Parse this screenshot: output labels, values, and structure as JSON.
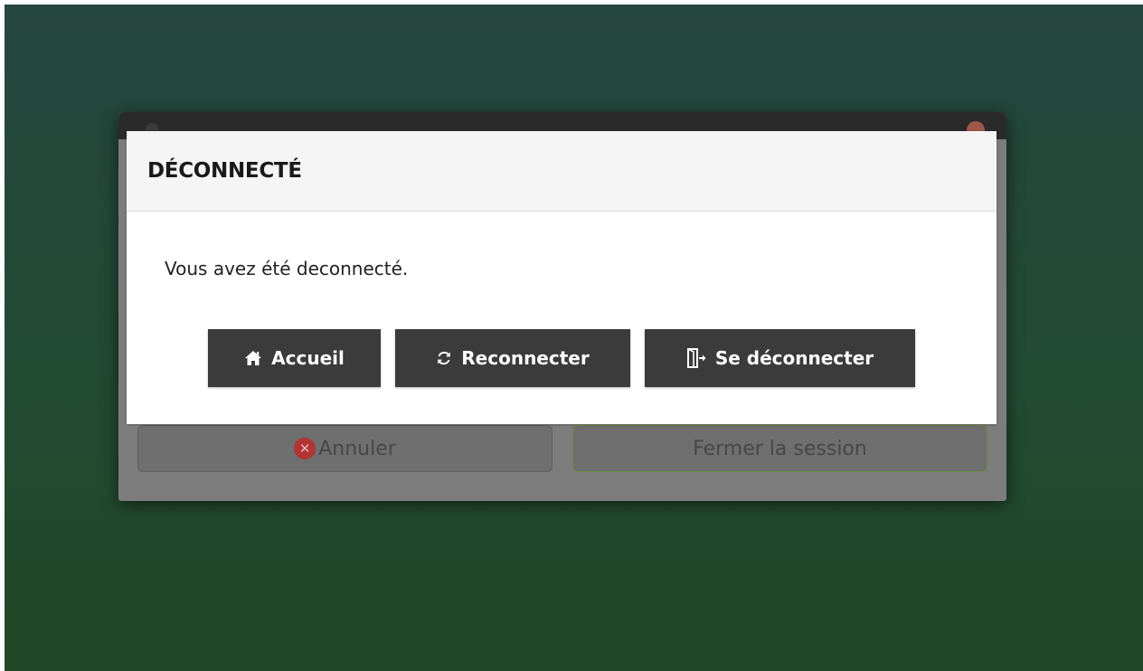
{
  "logout_window": {
    "cancel_label": "Annuler",
    "close_session_label": "Fermer la session"
  },
  "modal": {
    "title": "DÉCONNECTÉ",
    "message": "Vous avez été deconnecté.",
    "buttons": {
      "home": {
        "label": "Accueil",
        "icon": "home-icon"
      },
      "reconnect": {
        "label": "Reconnecter",
        "icon": "refresh-icon"
      },
      "logout": {
        "label": "Se déconnecter",
        "icon": "sign-out-icon"
      }
    }
  },
  "colors": {
    "button_bg": "#3b3b3b",
    "cancel_icon": "#b23434",
    "close_session_border": "#6c8a45"
  }
}
